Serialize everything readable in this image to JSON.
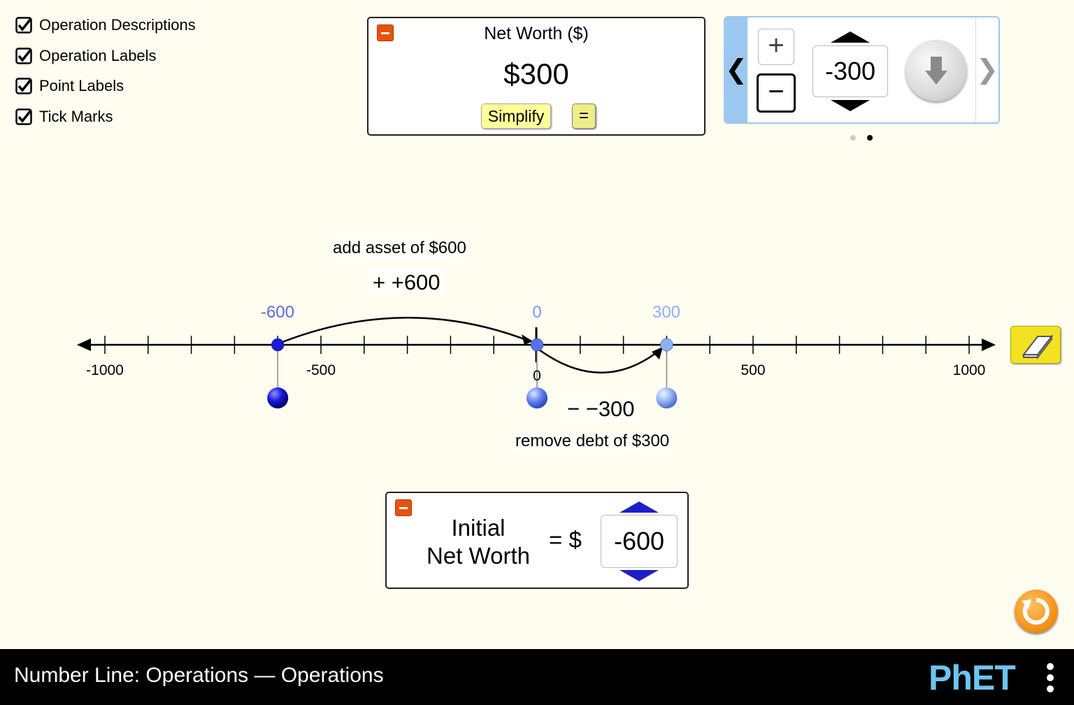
{
  "checkboxes": [
    {
      "label": "Operation Descriptions",
      "checked": true
    },
    {
      "label": "Operation Labels",
      "checked": true
    },
    {
      "label": "Point Labels",
      "checked": true
    },
    {
      "label": "Tick Marks",
      "checked": true
    }
  ],
  "net_worth_box": {
    "title": "Net Worth ($)",
    "value": "$300",
    "simplify_label": "Simplify",
    "equals_label": "="
  },
  "operation_panel": {
    "plus_symbol": "+",
    "minus_symbol": "−",
    "selected_operation": "minus",
    "amount": "-300",
    "page_count": 2,
    "current_page": 2
  },
  "number_line": {
    "min": -1000,
    "max": 1000,
    "tick_spacing": 100,
    "tick_labels": [
      "-1000",
      "-500",
      "0",
      "500",
      "1000"
    ],
    "points": [
      {
        "value": -600,
        "label": "-600",
        "color": "#1a1ad8"
      },
      {
        "value": 0,
        "label": "0",
        "color": "#5572f5"
      },
      {
        "value": 300,
        "label": "300",
        "color": "#8fb0f8"
      }
    ],
    "operations": [
      {
        "description": "add asset of $600",
        "label": "+ +600",
        "from": -600,
        "to": 0
      },
      {
        "description": "remove debt of $300",
        "label": "− −300",
        "from": 0,
        "to": 300
      }
    ]
  },
  "initial_net_worth": {
    "label_line1": "Initial",
    "label_line2": "Net Worth",
    "equals": "= $",
    "value": "-600"
  },
  "navbar": {
    "title": "Number Line: Operations — Operations",
    "logo": "PhET"
  },
  "colors": {
    "background": "#fffdf0",
    "minimize_button": "#e8520c",
    "carousel_border": "#9cc8f0",
    "reset_button": "#f7941d",
    "eraser": "#f2e222"
  }
}
